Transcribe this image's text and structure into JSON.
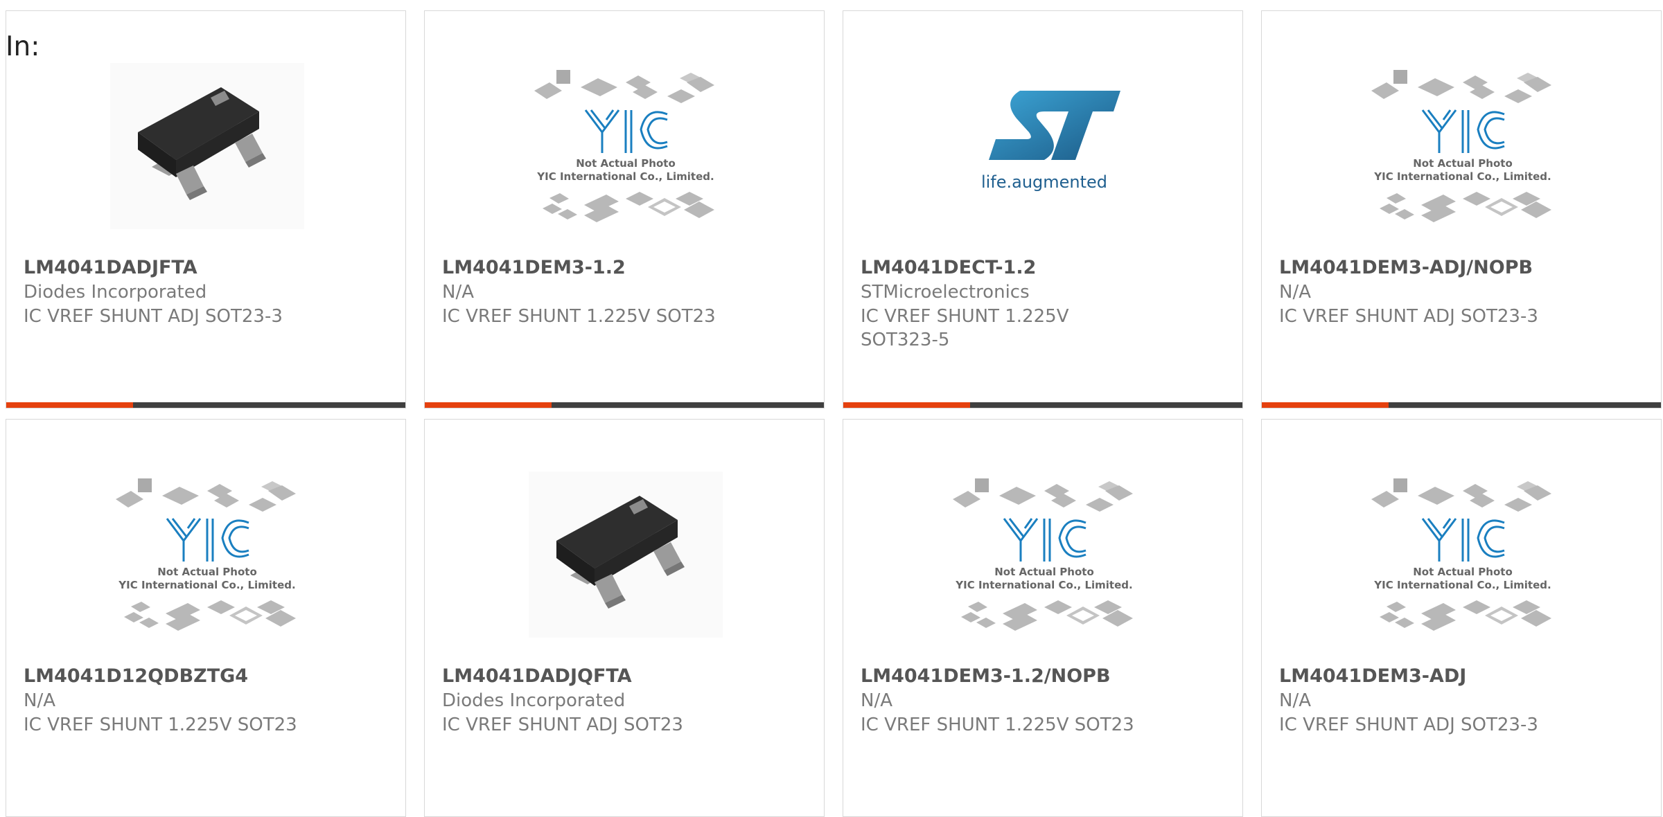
{
  "header": {
    "in_label": "In:"
  },
  "placeholder": {
    "line1": "Not Actual Photo",
    "line2": "YIC International Co., Limited."
  },
  "st_logo": {
    "tagline": "life.augmented"
  },
  "products": [
    {
      "part": "LM4041DADJFTA",
      "manufacturer": "Diodes Incorporated",
      "description": "IC VREF SHUNT ADJ SOT23-3",
      "image": "sot23-chip"
    },
    {
      "part": "LM4041DEM3-1.2",
      "manufacturer": "N/A",
      "description": "IC VREF SHUNT 1.225V SOT23",
      "image": "yic-placeholder"
    },
    {
      "part": "LM4041DECT-1.2",
      "manufacturer": "STMicroelectronics",
      "description": "IC VREF SHUNT 1.225V SOT323-5",
      "image": "st-logo"
    },
    {
      "part": "LM4041DEM3-ADJ/NOPB",
      "manufacturer": "N/A",
      "description": "IC VREF SHUNT ADJ SOT23-3",
      "image": "yic-placeholder"
    },
    {
      "part": "LM4041D12QDBZTG4",
      "manufacturer": "N/A",
      "description": "IC VREF SHUNT 1.225V SOT23",
      "image": "yic-placeholder"
    },
    {
      "part": "LM4041DADJQFTA",
      "manufacturer": "Diodes Incorporated",
      "description": "IC VREF SHUNT ADJ SOT23",
      "image": "sot23-chip"
    },
    {
      "part": "LM4041DEM3-1.2/NOPB",
      "manufacturer": "N/A",
      "description": "IC VREF SHUNT 1.225V SOT23",
      "image": "yic-placeholder"
    },
    {
      "part": "LM4041DEM3-ADJ",
      "manufacturer": "N/A",
      "description": "IC VREF SHUNT ADJ SOT23-3",
      "image": "yic-placeholder"
    }
  ],
  "colors": {
    "accent": "#e5410f",
    "bar": "#404040",
    "yic_blue": "#1a7fc0",
    "st_blue": "#1f5f8f"
  }
}
